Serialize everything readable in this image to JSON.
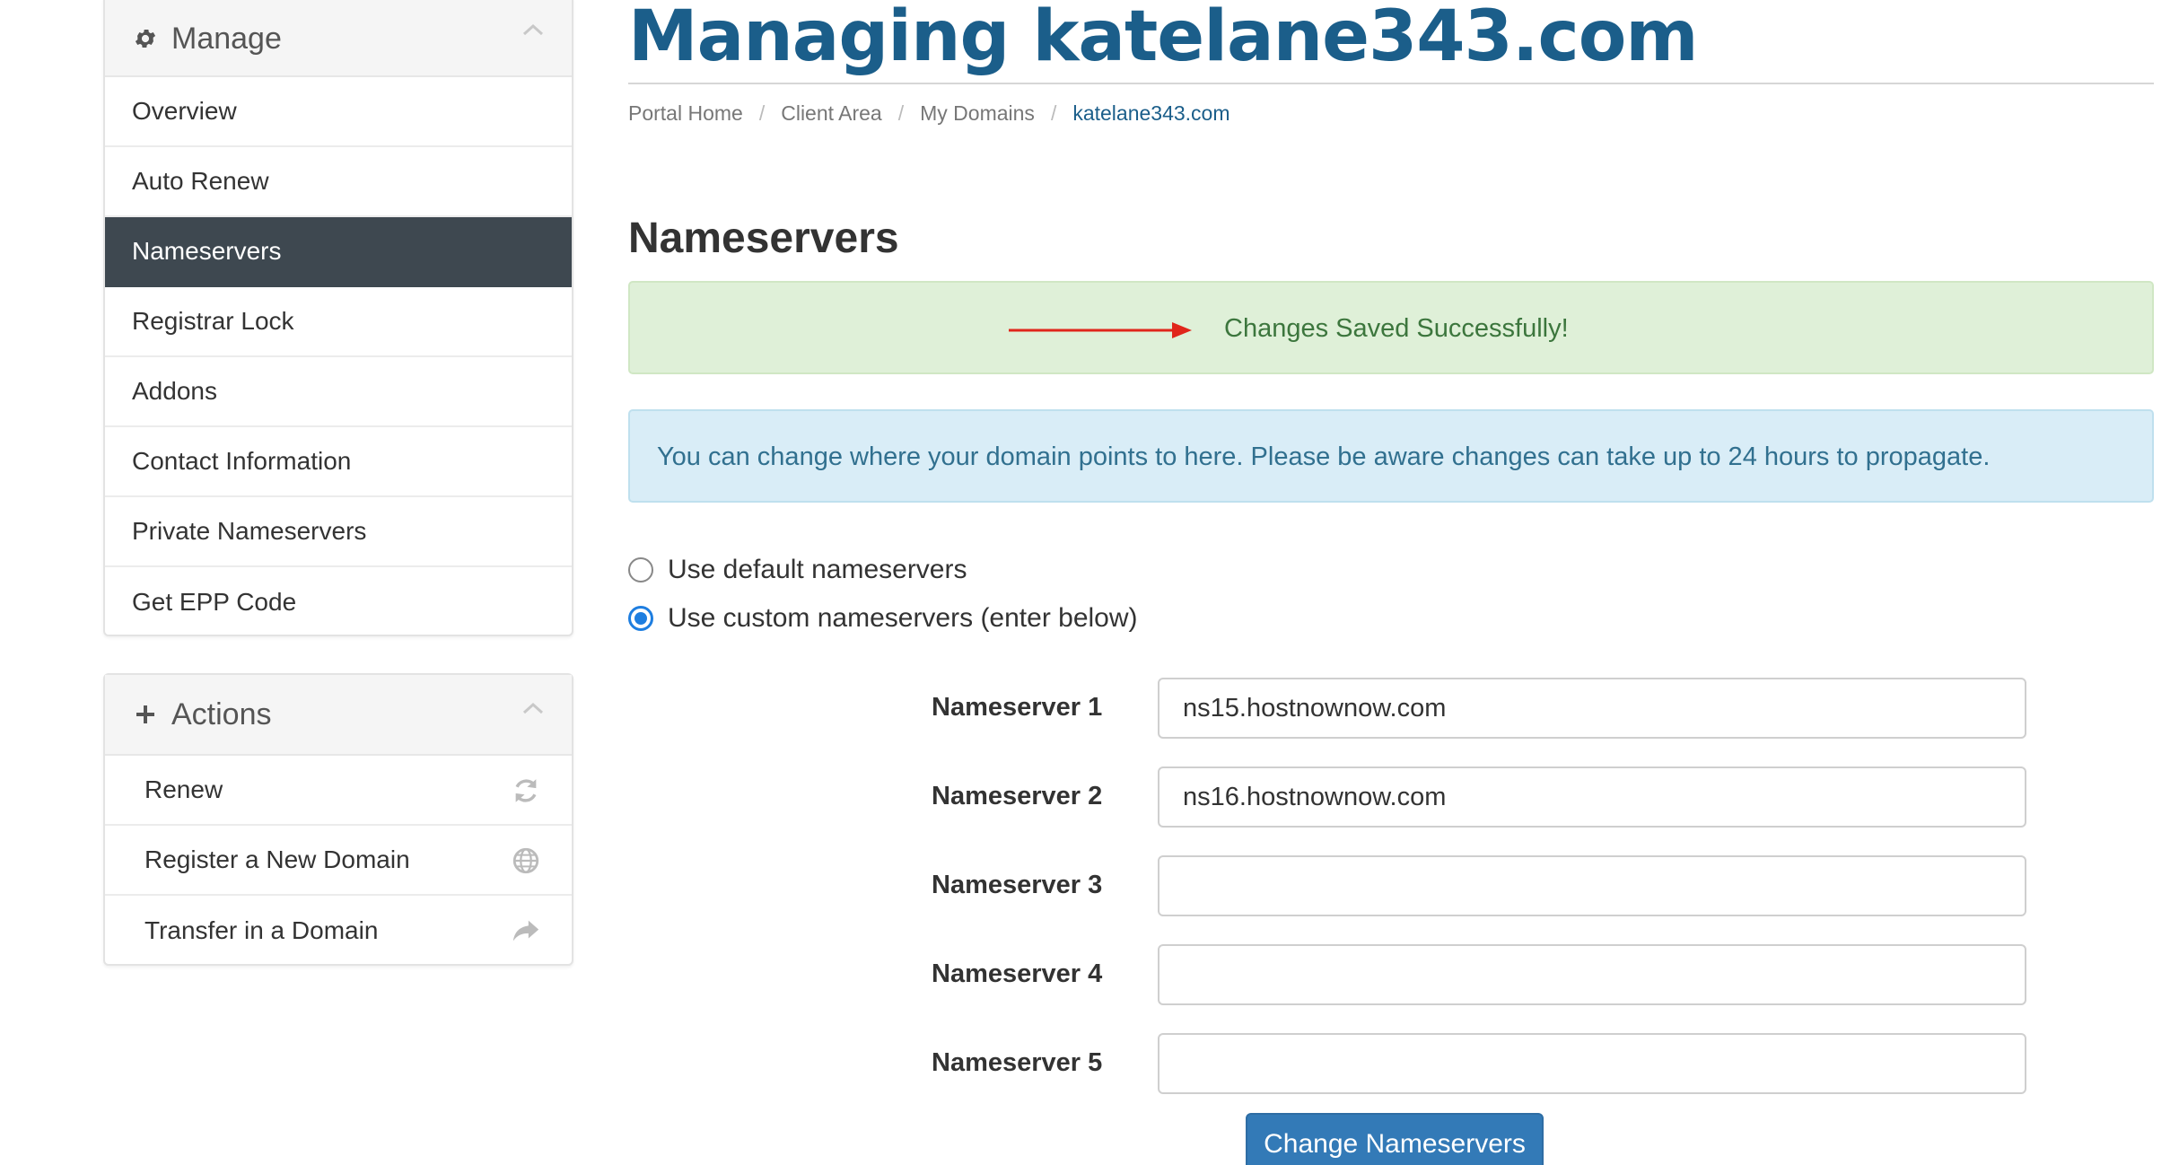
{
  "sidebar": {
    "manage": {
      "title": "Manage",
      "icon": "gear-icon",
      "items": [
        {
          "label": "Overview",
          "active": false
        },
        {
          "label": "Auto Renew",
          "active": false
        },
        {
          "label": "Nameservers",
          "active": true
        },
        {
          "label": "Registrar Lock",
          "active": false
        },
        {
          "label": "Addons",
          "active": false
        },
        {
          "label": "Contact Information",
          "active": false
        },
        {
          "label": "Private Nameservers",
          "active": false
        },
        {
          "label": "Get EPP Code",
          "active": false
        }
      ]
    },
    "actions": {
      "title": "Actions",
      "icon": "plus-icon",
      "items": [
        {
          "label": "Renew",
          "icon": "refresh-icon"
        },
        {
          "label": "Register a New Domain",
          "icon": "globe-icon"
        },
        {
          "label": "Transfer in a Domain",
          "icon": "share-arrow-icon"
        }
      ]
    }
  },
  "header": {
    "title": "Managing katelane343.com",
    "breadcrumb": [
      "Portal Home",
      "Client Area",
      "My Domains",
      "katelane343.com"
    ]
  },
  "main": {
    "section_title": "Nameservers",
    "success_message": "Changes Saved Successfully!",
    "info_message": "You can change where your domain points to here. Please be aware changes can take up to 24 hours to propagate.",
    "options": [
      {
        "label": "Use default nameservers",
        "checked": false
      },
      {
        "label": "Use custom nameservers (enter below)",
        "checked": true
      }
    ],
    "nameservers": [
      {
        "label": "Nameserver 1",
        "value": "ns15.hostnownow.com"
      },
      {
        "label": "Nameserver 2",
        "value": "ns16.hostnownow.com"
      },
      {
        "label": "Nameserver 3",
        "value": ""
      },
      {
        "label": "Nameserver 4",
        "value": ""
      },
      {
        "label": "Nameserver 5",
        "value": ""
      }
    ],
    "submit_label": "Change Nameservers"
  },
  "colors": {
    "accent": "#1b5e8a",
    "active_nav": "#3e4850",
    "success_bg": "#dff0d8",
    "info_bg": "#d9edf7",
    "button": "#337ab7",
    "annotation_arrow": "#e0261b"
  }
}
